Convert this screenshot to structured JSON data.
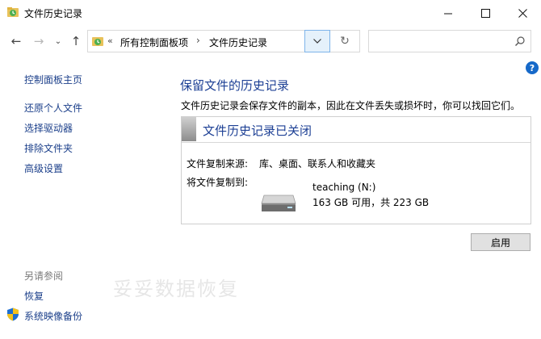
{
  "window": {
    "title": "文件历史记录",
    "minimize_icon": "minimize-icon",
    "maximize_icon": "maximize-icon",
    "close_icon": "close-icon"
  },
  "address_bar": {
    "overflow": "«",
    "crumbs": [
      "所有控制面板项",
      "文件历史记录"
    ],
    "separator": "›"
  },
  "search": {
    "placeholder": ""
  },
  "sidebar": {
    "home": "控制面板主页",
    "items": [
      "还原个人文件",
      "选择驱动器",
      "排除文件夹",
      "高级设置"
    ],
    "see_also_title": "另请参阅",
    "see_also": [
      "恢复",
      "系统映像备份"
    ]
  },
  "main": {
    "title": "保留文件的历史记录",
    "description": "文件历史记录会保存文件的副本，因此在文件丢失或损坏时，你可以找回它们。",
    "status_title": "文件历史记录已关闭",
    "source_label": "文件复制来源:",
    "source_value": "库、桌面、联系人和收藏夹",
    "dest_label": "将文件复制到:",
    "drive_name": "teaching (N:)",
    "drive_space": "163 GB 可用，共 223 GB",
    "enable_button": "启用"
  },
  "watermark": "妥妥数据恢复",
  "colors": {
    "link": "#1b3f8a",
    "heading": "#1c3f94",
    "help": "#1669c9",
    "dropdown_highlight": "#e5f1fb"
  }
}
